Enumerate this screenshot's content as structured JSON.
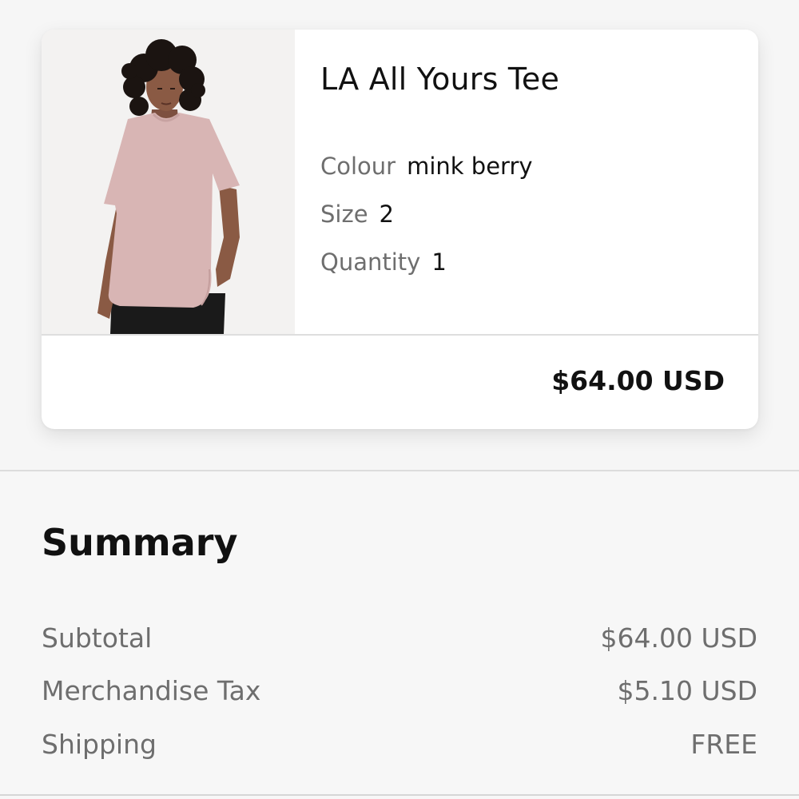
{
  "product": {
    "name": "LA All Yours Tee",
    "image_alt": "model-wearing-pink-tee",
    "attributes": [
      {
        "label": "Colour",
        "value": "mink berry"
      },
      {
        "label": "Size",
        "value": "2"
      },
      {
        "label": "Quantity",
        "value": "1"
      }
    ],
    "price": "$64.00 USD"
  },
  "summary": {
    "title": "Summary",
    "rows": [
      {
        "label": "Subtotal",
        "value": "$64.00 USD"
      },
      {
        "label": "Merchandise Tax",
        "value": "$5.10 USD"
      },
      {
        "label": "Shipping",
        "value": "FREE"
      }
    ]
  },
  "colors": {
    "tee": "#d8b5b4",
    "pants": "#1a1a1a",
    "skin": "#8a5a44",
    "hair": "#1b1411"
  }
}
